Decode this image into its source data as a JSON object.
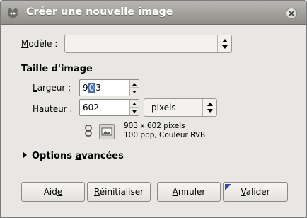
{
  "window": {
    "title": "Créer une nouvelle image"
  },
  "template": {
    "label_before": "",
    "label_mnemonic": "M",
    "label_after": "odèle :",
    "value": ""
  },
  "image_size": {
    "section_title": "Taille d'image",
    "width_label_mnemonic": "L",
    "width_label_rest": "argeur :",
    "width_value_before_sel": "9",
    "width_value_sel": "0",
    "width_value_after_sel": "3",
    "height_label_mnemonic": "H",
    "height_label_rest": "auteur :",
    "height_value": "602",
    "unit_value": "pixels",
    "info_line1": "903 x 602 pixels",
    "info_line2": "100 ppp, Couleur RVB"
  },
  "advanced": {
    "label_before": "Options ",
    "label_mnemonic": "a",
    "label_after": "vancées"
  },
  "buttons": {
    "help_before": "Aid",
    "help_mnemonic": "e",
    "help_after": "",
    "reset_before": "",
    "reset_mnemonic": "R",
    "reset_after": "éinitialiser",
    "cancel_before": "",
    "cancel_mnemonic": "A",
    "cancel_after": "nnuler",
    "ok_before": "",
    "ok_mnemonic": "V",
    "ok_after": "alider"
  },
  "icons": {
    "app": "gimp-wilber-icon",
    "close": "close-icon",
    "combo_arrows": "up-down-arrows-icon",
    "chain": "chain-link-icon",
    "aspect": "landscape-image-icon",
    "expander": "triangle-right-icon"
  }
}
